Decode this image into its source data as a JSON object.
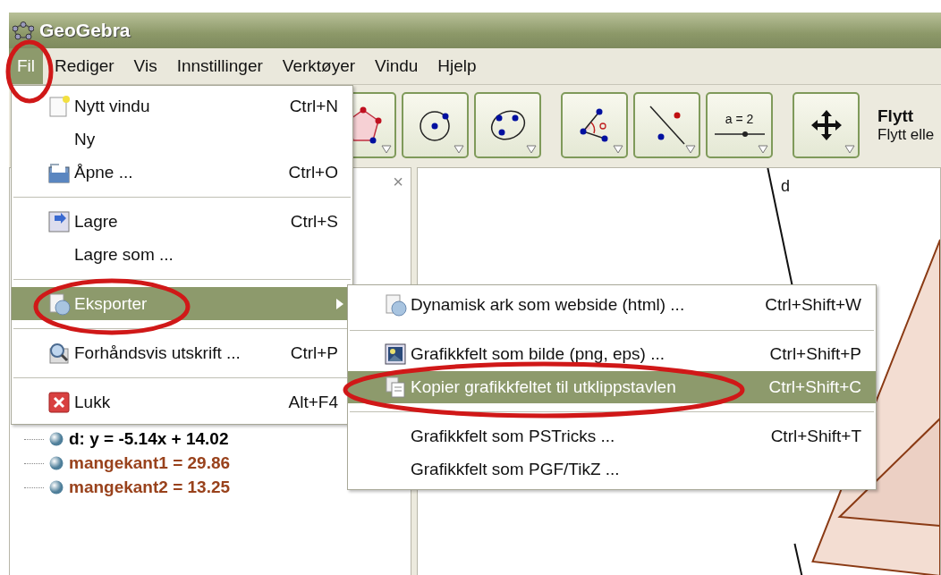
{
  "window": {
    "title": "GeoGebra"
  },
  "menubar": [
    {
      "label": "Fil",
      "selected": true
    },
    {
      "label": "Rediger",
      "selected": false
    },
    {
      "label": "Vis",
      "selected": false
    },
    {
      "label": "Innstillinger",
      "selected": false
    },
    {
      "label": "Verktøyer",
      "selected": false
    },
    {
      "label": "Vindu",
      "selected": false
    },
    {
      "label": "Hjelp",
      "selected": false
    }
  ],
  "toolbar": {
    "tools": [
      {
        "kind": "polygon"
      },
      {
        "kind": "circle"
      },
      {
        "kind": "conic"
      },
      {
        "kind": "angle"
      },
      {
        "kind": "parallel"
      },
      {
        "kind": "slider",
        "label": "a = 2"
      },
      {
        "kind": "move"
      }
    ],
    "tool_name": "Flytt",
    "tool_help": "Flytt elle"
  },
  "file_menu": [
    {
      "kind": "item",
      "label": "Nytt vindu",
      "shortcut": "Ctrl+N",
      "selected": false
    },
    {
      "kind": "item",
      "label": "Ny",
      "selected": false
    },
    {
      "kind": "item",
      "label": "Åpne ...",
      "shortcut": "Ctrl+O",
      "selected": false
    },
    {
      "kind": "separator"
    },
    {
      "kind": "item",
      "label": "Lagre",
      "shortcut": "Ctrl+S",
      "selected": false
    },
    {
      "kind": "item",
      "label": "Lagre som ...",
      "selected": false
    },
    {
      "kind": "separator"
    },
    {
      "kind": "submenu",
      "label": "Eksporter",
      "selected": true
    },
    {
      "kind": "separator"
    },
    {
      "kind": "item",
      "label": "Forhåndsvis utskrift ...",
      "shortcut": "Ctrl+P",
      "selected": false
    },
    {
      "kind": "separator"
    },
    {
      "kind": "item",
      "label": "Lukk",
      "shortcut": "Alt+F4",
      "selected": false
    }
  ],
  "export_menu": [
    {
      "kind": "item",
      "label": "Dynamisk ark som webside (html) ...",
      "shortcut": "Ctrl+Shift+W",
      "selected": false
    },
    {
      "kind": "separator"
    },
    {
      "kind": "item",
      "label": "Grafikkfelt som bilde (png, eps) ...",
      "shortcut": "Ctrl+Shift+P",
      "selected": false
    },
    {
      "kind": "item",
      "label": "Kopier grafikkfeltet til utklippstavlen",
      "shortcut": "Ctrl+Shift+C",
      "selected": true
    },
    {
      "kind": "separator"
    },
    {
      "kind": "item",
      "label": "Grafikkfelt som PSTricks ...",
      "shortcut": "Ctrl+Shift+T",
      "selected": false
    },
    {
      "kind": "item",
      "label": "Grafikkfelt som PGF/TikZ ...",
      "selected": false
    }
  ],
  "algebra": {
    "close": "×",
    "items": [
      {
        "text": "d: y = -5.14x + 14.02",
        "color": "#000000"
      },
      {
        "text": "mangekant1 = 29.86",
        "color": "#99421c"
      },
      {
        "text": "mangekant2 = 13.25",
        "color": "#99421c"
      }
    ]
  },
  "graphics": {
    "line_label": "d"
  }
}
